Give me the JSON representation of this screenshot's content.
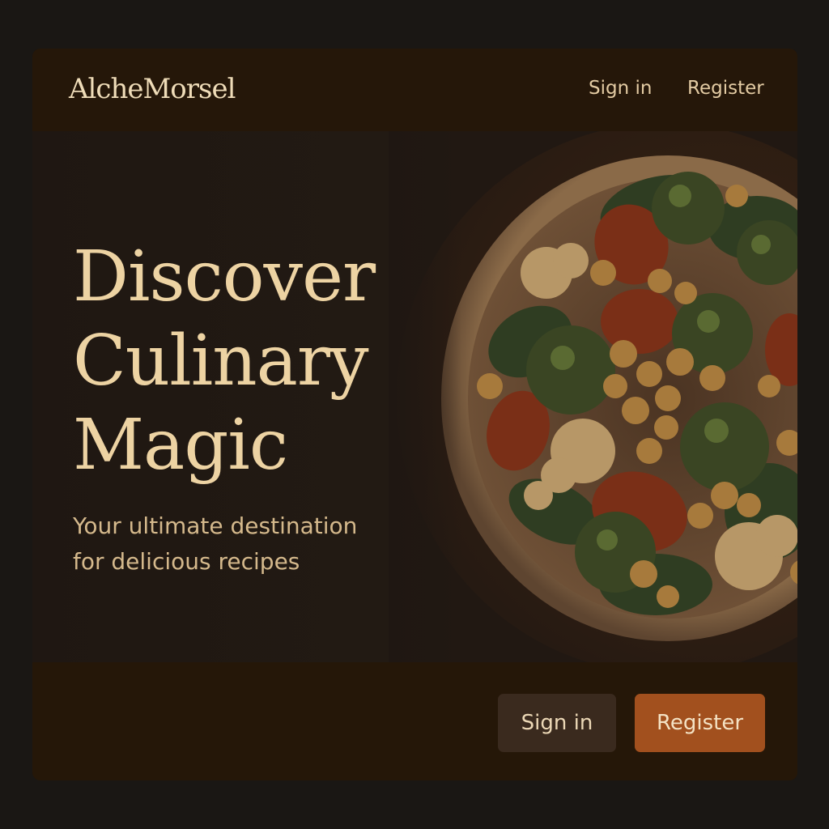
{
  "header": {
    "logo": "AlcheMorsel",
    "nav": {
      "sign_in": "Sign in",
      "register": "Register"
    }
  },
  "hero": {
    "title_lines": [
      "Discover",
      "Culinary",
      "Magic"
    ],
    "subtitle_lines": [
      "Your ultimate destination",
      "for delicious recipes"
    ],
    "image": "vegetable-bowl-image"
  },
  "footer": {
    "sign_in_button": "Sign in",
    "register_button": "Register"
  },
  "colors": {
    "background": "#1a1714",
    "panel": "#221812",
    "bar": "#251709",
    "headline": "#edd3a3",
    "accent_button": "#a2501e",
    "secondary_button": "#3a2a1e"
  }
}
